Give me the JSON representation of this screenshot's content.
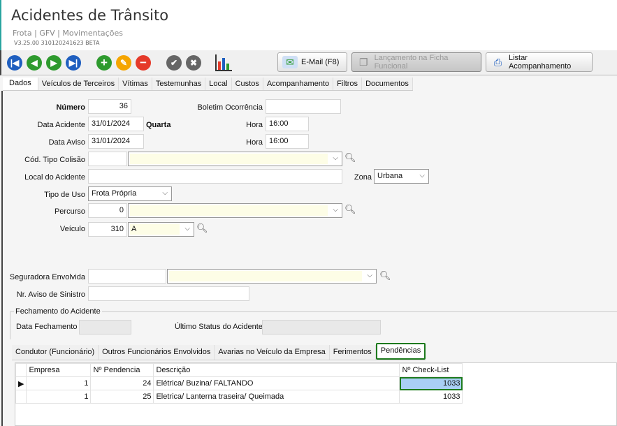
{
  "header": {
    "title": "Acidentes de Trânsito",
    "breadcrumb": "Frota | GFV | Movimentações",
    "version": "V3.25.00 310120241623 BETA"
  },
  "toolbar": {
    "nav_icons": [
      "first-icon",
      "previous-icon",
      "next-icon",
      "last-icon"
    ],
    "action_icons": [
      "add-icon",
      "edit-icon",
      "delete-icon",
      "confirm-icon",
      "cancel-icon",
      "report-settings-icon"
    ],
    "email_label": "E-Mail (F8)",
    "lancamento_label": "Lançamento na Ficha Funcional",
    "listar_label": "Listar Acompanhamento"
  },
  "tabs": [
    "Dados",
    "Veículos de Terceiros",
    "Vítimas",
    "Testemunhas",
    "Local",
    "Custos",
    "Acompanhamento",
    "Filtros",
    "Documentos"
  ],
  "form": {
    "numero_label": "Número",
    "numero": "36",
    "boletim_label": "Boletim Ocorrência",
    "boletim": "",
    "data_acidente_label": "Data Acidente",
    "data_acidente": "31/01/2024",
    "dia_semana": "Quarta",
    "hora_label": "Hora",
    "hora_acidente": "16:00",
    "data_aviso_label": "Data Aviso",
    "data_aviso": "31/01/2024",
    "hora_aviso": "16:00",
    "tipo_colisao_label": "Cód. Tipo Colisão",
    "tipo_colisao_cod": "",
    "tipo_colisao": "",
    "local_label": "Local do Acidente",
    "local": "",
    "zona_label": "Zona",
    "zona": "Urbana",
    "tipo_uso_label": "Tipo de Uso",
    "tipo_uso": "Frota Própria",
    "percurso_label": "Percurso",
    "percurso_cod": "0",
    "percurso": "",
    "veiculo_label": "Veículo",
    "veiculo_cod": "310",
    "veiculo": "A",
    "seguradora_label": "Seguradora Envolvida",
    "seguradora_cod": "",
    "seguradora": "",
    "aviso_sinistro_label": "Nr. Aviso de Sinistro",
    "aviso_sinistro": "",
    "fechamento_group": "Fechamento do Acidente",
    "data_fechamento_label": "Data Fechamento",
    "data_fechamento": "",
    "ultimo_status_label": "Último Status do Acidente",
    "ultimo_status": ""
  },
  "subtabs": [
    "Condutor (Funcionário)",
    "Outros Funcionários Envolvidos",
    "Avarias no Veículo da Empresa",
    "Ferimentos",
    "Pendências"
  ],
  "grid": {
    "columns": [
      "Empresa",
      "Nº Pendencia",
      "Descrição",
      "Nº Check-List"
    ],
    "rows": [
      [
        "1",
        "24",
        "Elétrica/ Buzina/ FALTANDO",
        "1033"
      ],
      [
        "1",
        "25",
        "Eletrica/ Lanterna traseira/ Queimada",
        "1033"
      ]
    ]
  }
}
